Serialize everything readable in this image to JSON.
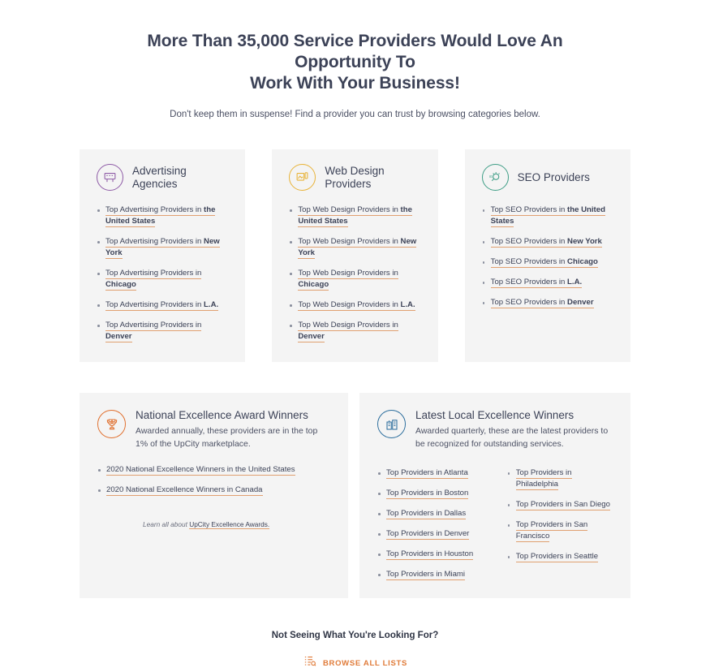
{
  "header": {
    "headline_line1": "More Than 35,000 Service Providers Would Love An Opportunity To",
    "headline_line2": "Work With Your Business!",
    "subhead": "Don't keep them in suspense! Find a provider you can trust by browsing categories below."
  },
  "colors": {
    "card_bg": "#f4f4f4",
    "text": "#3c4257",
    "link_underline": "#e0a070",
    "accent_orange": "#e07b39",
    "icon_purple": "#8e5ba6",
    "icon_yellow": "#e8b339",
    "icon_green": "#3f9e86",
    "icon_orange": "#e0702f",
    "icon_blue": "#2e6f9e"
  },
  "top_cards": [
    {
      "title": "Advertising Agencies",
      "icon": "billboard-icon",
      "icon_color": "#8e5ba6",
      "links": [
        {
          "prefix": "Top Advertising Providers in ",
          "place": "the United States"
        },
        {
          "prefix": "Top Advertising Providers in ",
          "place": "New York"
        },
        {
          "prefix": "Top Advertising Providers in ",
          "place": "Chicago"
        },
        {
          "prefix": "Top Advertising Providers in ",
          "place": "L.A."
        },
        {
          "prefix": "Top Advertising Providers in ",
          "place": "Denver"
        }
      ]
    },
    {
      "title": "Web Design Providers",
      "icon": "web-layout-icon",
      "icon_color": "#e8b339",
      "links": [
        {
          "prefix": "Top Web Design Providers in ",
          "place": "the United States"
        },
        {
          "prefix": "Top Web Design Providers in ",
          "place": "New York"
        },
        {
          "prefix": "Top Web Design Providers in ",
          "place": "Chicago"
        },
        {
          "prefix": "Top Web Design Providers in ",
          "place": "L.A."
        },
        {
          "prefix": "Top Web Design Providers in ",
          "place": "Denver"
        }
      ]
    },
    {
      "title": "SEO Providers",
      "icon": "seo-magnifier-icon",
      "icon_color": "#3f9e86",
      "links": [
        {
          "prefix": "Top SEO Providers in ",
          "place": "the United States"
        },
        {
          "prefix": "Top SEO Providers in ",
          "place": "New York"
        },
        {
          "prefix": "Top SEO Providers in ",
          "place": "Chicago"
        },
        {
          "prefix": "Top SEO Providers in ",
          "place": "L.A."
        },
        {
          "prefix": "Top SEO Providers in ",
          "place": "Denver"
        }
      ]
    }
  ],
  "national_card": {
    "title": "National Excellence Award Winners",
    "icon": "trophy-icon",
    "icon_color": "#e0702f",
    "description": "Awarded annually, these providers are in the top 1% of the UpCity marketplace.",
    "links": [
      "2020 National Excellence Winners in the United States",
      "2020 National Excellence Winners in Canada"
    ],
    "learn_prefix": "Learn all about ",
    "learn_link": "UpCity Excellence Awards."
  },
  "local_card": {
    "title": "Latest Local Excellence Winners",
    "icon": "city-buildings-icon",
    "icon_color": "#2e6f9e",
    "description": "Awarded quarterly, these are the latest providers to be recognized for outstanding services.",
    "column_a": [
      "Top Providers in Atlanta",
      "Top Providers in Boston",
      "Top Providers in Dallas",
      "Top Providers in Denver",
      "Top Providers in Houston",
      "Top Providers in Miami"
    ],
    "column_b": [
      "Top Providers in Philadelphia",
      "Top Providers in San Diego",
      "Top Providers in San Francisco",
      "Top Providers in Seattle"
    ]
  },
  "footer": {
    "title": "Not Seeing What You're Looking For?",
    "browse_label": "BROWSE ALL LISTS",
    "browse_icon": "list-search-icon"
  }
}
